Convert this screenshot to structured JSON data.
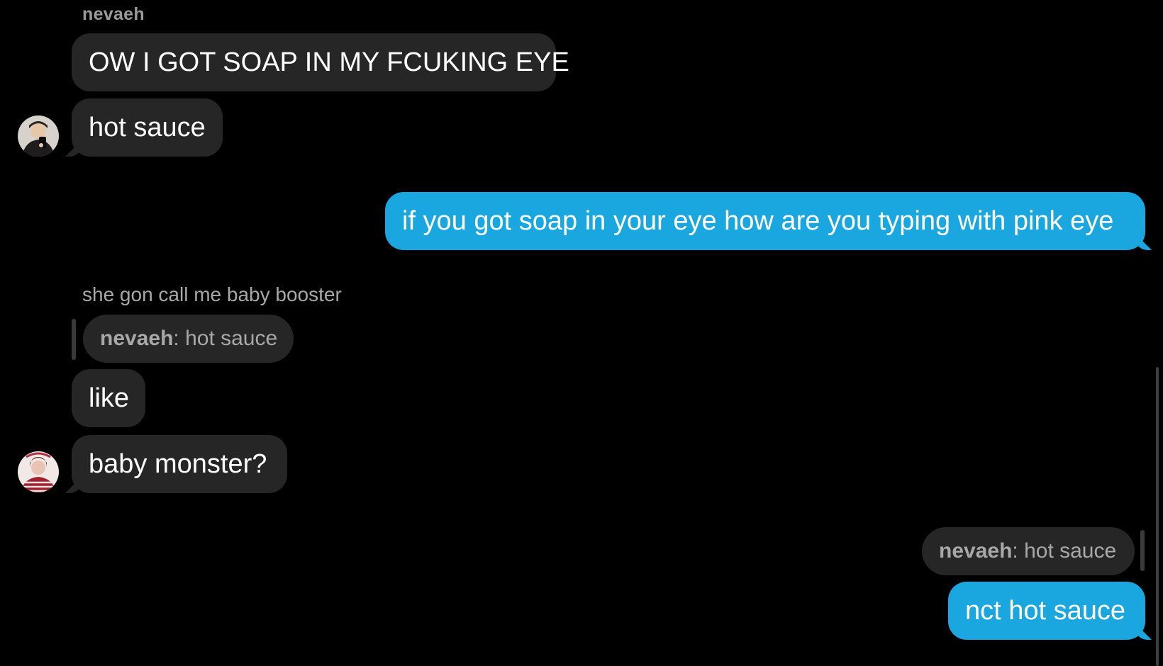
{
  "thread": {
    "sender_name": "nevaeh",
    "messages": [
      {
        "text": "OW I GOT SOAP IN MY FCUKING EYE"
      },
      {
        "text": "hot sauce"
      },
      {
        "text": "if you got soap in your eye how are you typing with pink eye"
      },
      {
        "text": "like"
      },
      {
        "text": "baby monster?"
      },
      {
        "text": "nct hot sauce"
      }
    ],
    "reply_caption": "she gon call me baby booster",
    "quote_left": {
      "name": "nevaeh",
      "separator": ":",
      "text": " hot sauce"
    },
    "quote_right": {
      "name": "nevaeh",
      "separator": ":",
      "text": " hot sauce"
    }
  },
  "colors": {
    "background": "#000000",
    "incoming_bubble": "#262626",
    "outgoing_bubble": "#1aa7e0",
    "secondary_text": "#a8a8a8"
  }
}
